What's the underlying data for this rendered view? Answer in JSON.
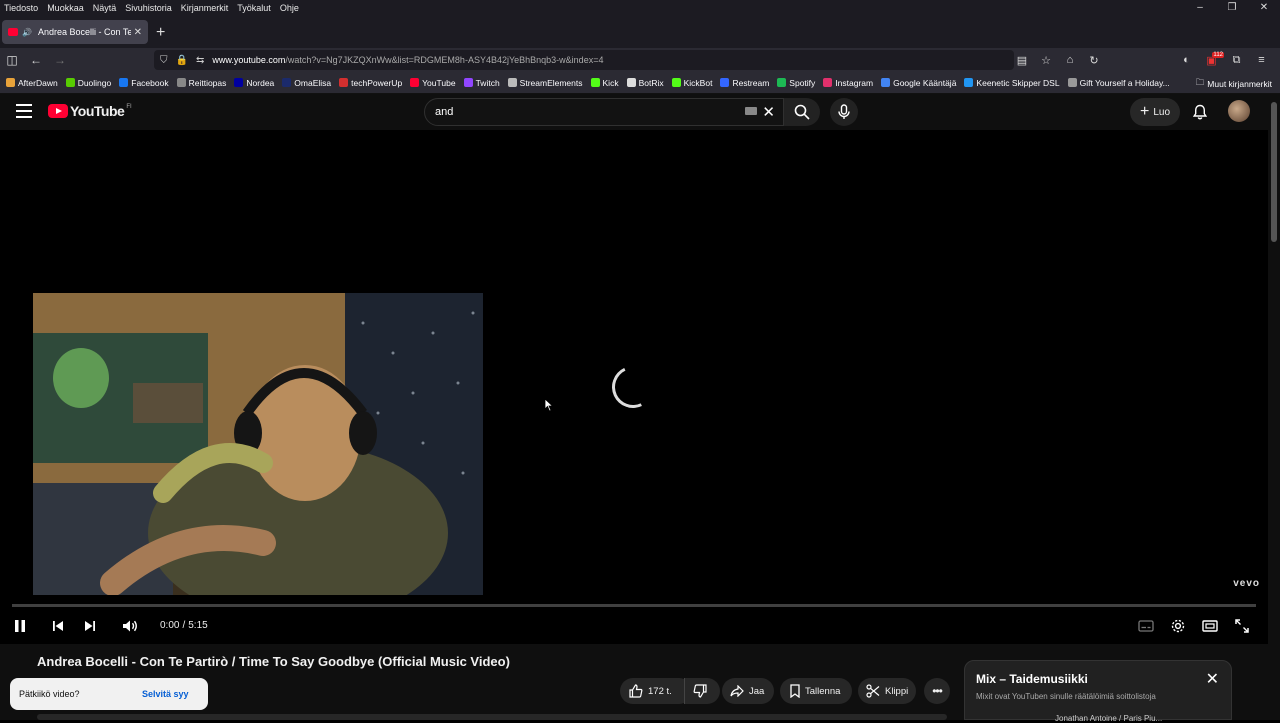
{
  "browser": {
    "menu": [
      "Tiedosto",
      "Muokkaa",
      "Näytä",
      "Sivuhistoria",
      "Kirjanmerkit",
      "Työkalut",
      "Ohje"
    ],
    "tab_title": "Andrea Bocelli - Con Te Part",
    "url_host": "www.youtube.com",
    "url_path": "/watch?v=Ng7JKZQXnWw&list=RDGMEM8h-ASY4B42jYeBhBnqb3-w&index=4",
    "ext_badge": "112",
    "bookmarks": [
      {
        "label": "AfterDawn",
        "color": "#e8a23a"
      },
      {
        "label": "Duolingo",
        "color": "#58cc02"
      },
      {
        "label": "Facebook",
        "color": "#1877f2"
      },
      {
        "label": "Reittiopas",
        "color": "#888888"
      },
      {
        "label": "Nordea",
        "color": "#0000a0"
      },
      {
        "label": "OmaElisa",
        "color": "#1b2a6b"
      },
      {
        "label": "techPowerUp",
        "color": "#d32f2f"
      },
      {
        "label": "YouTube",
        "color": "#ff0033"
      },
      {
        "label": "Twitch",
        "color": "#9146ff"
      },
      {
        "label": "StreamElements",
        "color": "#bbbbbb"
      },
      {
        "label": "Kick",
        "color": "#53fc18"
      },
      {
        "label": "BotRix",
        "color": "#dddddd"
      },
      {
        "label": "KickBot",
        "color": "#53fc18"
      },
      {
        "label": "Restream",
        "color": "#3366ff"
      },
      {
        "label": "Spotify",
        "color": "#1db954"
      },
      {
        "label": "Instagram",
        "color": "#e1306c"
      },
      {
        "label": "Google Kääntäjä",
        "color": "#4285f4"
      },
      {
        "label": "Keenetic Skipper DSL",
        "color": "#2196f3"
      },
      {
        "label": "Gift Yourself a Holiday...",
        "color": "#999999"
      }
    ],
    "bookmarks_other": "Muut kirjanmerkit"
  },
  "youtube": {
    "logo_text": "YouTube",
    "country": "FI",
    "search_value": "and",
    "create_label": "Luo",
    "vevo": "vevo",
    "time_current": "0:00",
    "time_sep": "/",
    "time_total": "5:15",
    "video_title": "Andrea Bocelli - Con Te Partirò / Time To Say Goodbye (Official Music Video)",
    "toast_text": "Pätkiikö video?",
    "toast_action": "Selvitä syy",
    "likes": "172 t.",
    "share": "Jaa",
    "save": "Tallenna",
    "clip": "Klippi",
    "mix_title": "Mix – Taidemusiikki",
    "mix_sub": "Mixit ovat YouTuben sinulle räätälöimiä soittolistoja",
    "mix_next": "Jonathan Antoine / Paris Piu..."
  },
  "colors": {
    "accent": "#ff0033",
    "link": "#065fd4",
    "bg": "#0f0f0f"
  }
}
